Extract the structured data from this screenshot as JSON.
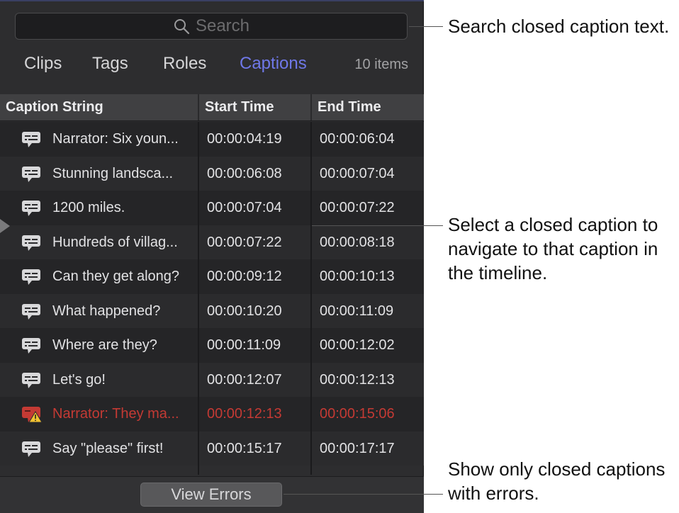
{
  "search": {
    "placeholder": "Search"
  },
  "tabs": [
    {
      "label": "Clips",
      "active": false
    },
    {
      "label": "Tags",
      "active": false
    },
    {
      "label": "Roles",
      "active": false
    },
    {
      "label": "Captions",
      "active": true
    }
  ],
  "items_count": "10 items",
  "columns": [
    "Caption String",
    "Start Time",
    "End Time"
  ],
  "rows": [
    {
      "text": "Narrator: Six youn...",
      "start": "00:00:04:19",
      "end": "00:00:06:04",
      "error": false
    },
    {
      "text": "Stunning landsca...",
      "start": "00:00:06:08",
      "end": "00:00:07:04",
      "error": false
    },
    {
      "text": "1200 miles.",
      "start": "00:00:07:04",
      "end": "00:00:07:22",
      "error": false
    },
    {
      "text": "Hundreds of villag...",
      "start": "00:00:07:22",
      "end": "00:00:08:18",
      "error": false
    },
    {
      "text": "Can they get along?",
      "start": "00:00:09:12",
      "end": "00:00:10:13",
      "error": false
    },
    {
      "text": "What happened?",
      "start": "00:00:10:20",
      "end": "00:00:11:09",
      "error": false
    },
    {
      "text": "Where are they?",
      "start": "00:00:11:09",
      "end": "00:00:12:02",
      "error": false
    },
    {
      "text": "Let's go!",
      "start": "00:00:12:07",
      "end": "00:00:12:13",
      "error": false
    },
    {
      "text": "Narrator: They ma...",
      "start": "00:00:12:13",
      "end": "00:00:15:06",
      "error": true
    },
    {
      "text": "Say \"please\" first!",
      "start": "00:00:15:17",
      "end": "00:00:17:17",
      "error": false
    }
  ],
  "footer": {
    "view_errors_label": "View Errors"
  },
  "callouts": {
    "search": "Search closed caption text.",
    "select": "Select a closed caption to navigate to that caption in the timeline.",
    "errors": "Show only closed captions with errors."
  },
  "colors": {
    "accent": "#6f78e8",
    "error": "#c43a34",
    "panel": "#2d2d2f"
  },
  "icons": {
    "caption": "caption-icon",
    "caption_error": "caption-warning-icon",
    "search": "search-icon"
  }
}
